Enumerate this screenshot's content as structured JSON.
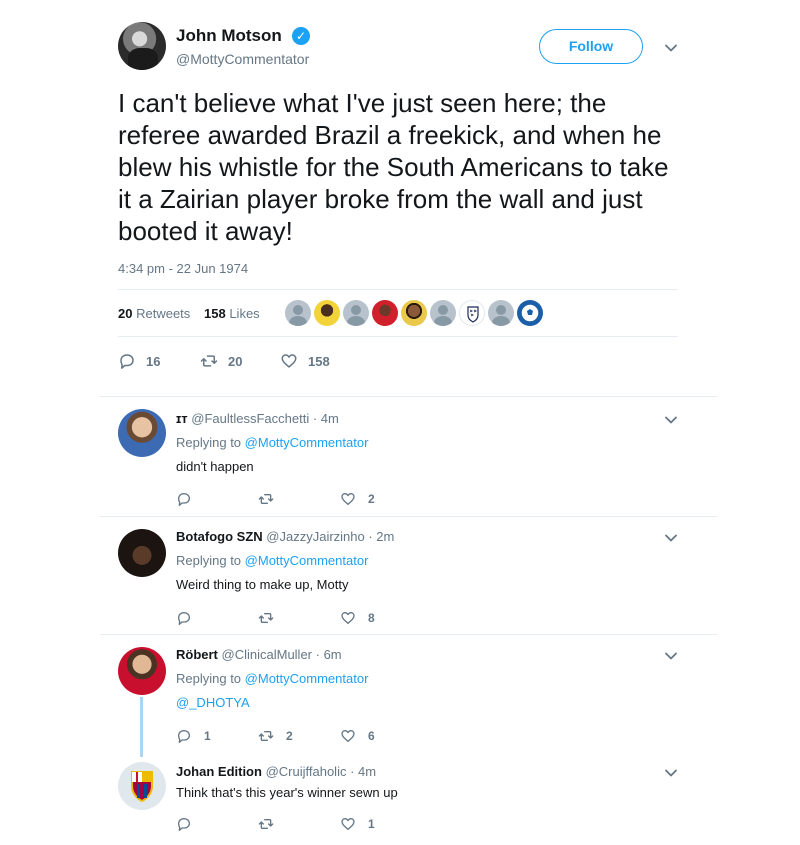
{
  "tweet": {
    "author_name": "John Motson",
    "author_handle": "@MottyCommentator",
    "follow_label": "Follow",
    "verified_glyph": "✓",
    "text": "I can't believe what I've just seen here; the referee awarded Brazil a freekick, and when he blew his whistle for the South Americans to take it a Zairian player broke from the wall and just booted it away!",
    "timestamp": "4:34 pm - 22 Jun 1974",
    "retweets_count": "20",
    "retweets_label": "Retweets",
    "likes_count": "158",
    "likes_label": "Likes",
    "actions": {
      "replies": "16",
      "retweets": "20",
      "likes": "158"
    },
    "likers": [
      {
        "style": "gray"
      },
      {
        "style": "pele"
      },
      {
        "style": "gray"
      },
      {
        "style": "red"
      },
      {
        "style": "face"
      },
      {
        "style": "gray"
      },
      {
        "style": "england"
      },
      {
        "style": "gray"
      },
      {
        "style": "ball"
      }
    ]
  },
  "replies": [
    {
      "name": "ɪᴛ",
      "handle": "@FaultlessFacchetti",
      "time": "· 4m",
      "replying_prefix": "Replying to",
      "replying_to": "@MottyCommentator",
      "text": "didn't happen",
      "text_is_link": false,
      "counts": {
        "replies": "",
        "retweets": "",
        "likes": "2"
      }
    },
    {
      "name": "Botafogo SZN",
      "handle": "@JazzyJairzinho",
      "time": "· 2m",
      "replying_prefix": "Replying to",
      "replying_to": "@MottyCommentator",
      "text": "Weird thing to make up, Motty",
      "text_is_link": false,
      "counts": {
        "replies": "",
        "retweets": "",
        "likes": "8"
      }
    },
    {
      "name": "Röbert",
      "handle": "@ClinicalMuller",
      "time": "· 6m",
      "replying_prefix": "Replying to",
      "replying_to": "@MottyCommentator",
      "text": "@_DHOTYA",
      "text_is_link": true,
      "counts": {
        "replies": "1",
        "retweets": "2",
        "likes": "6"
      }
    },
    {
      "name": "Johan Edition",
      "handle": "@Cruijffaholic",
      "time": "· 4m",
      "text": "Think that's this year's winner sewn up",
      "text_is_link": false,
      "counts": {
        "replies": "",
        "retweets": "",
        "likes": "1"
      }
    }
  ],
  "icons": {
    "reply": "reply-icon",
    "retweet": "retweet-icon",
    "like": "heart-icon",
    "caret": "chevron-down-icon"
  },
  "colors": {
    "accent": "#1da1f2",
    "muted": "#657786",
    "text": "#14171a"
  }
}
